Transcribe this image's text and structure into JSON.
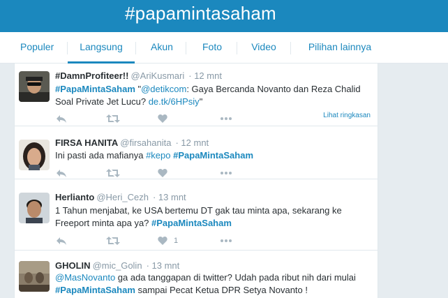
{
  "header": {
    "title": "#papamintasaham"
  },
  "nav": {
    "tabs": [
      {
        "label": "Populer",
        "active": false
      },
      {
        "label": "Langsung",
        "active": true
      },
      {
        "label": "Akun",
        "active": false
      },
      {
        "label": "Foto",
        "active": false
      },
      {
        "label": "Video",
        "active": false
      },
      {
        "label": "Pilihan lainnya",
        "active": false
      }
    ]
  },
  "tweets": [
    {
      "name": "#DamnProfiteer!!",
      "handle": "@AriKusmari",
      "time": "12 mnt",
      "text_parts": [
        {
          "t": "#PapaMintaSaham",
          "k": "tag"
        },
        {
          "t": " \"",
          "k": "plain"
        },
        {
          "t": "@detikcom",
          "k": "link"
        },
        {
          "t": ": Gaya Bercanda Novanto dan Reza Chalid Soal Private Jet Lucu? ",
          "k": "plain"
        },
        {
          "t": "de.tk/6HPsiy",
          "k": "link"
        },
        {
          "t": "\"",
          "k": "plain"
        }
      ],
      "summary_link": "Lihat ringkasan",
      "like_count": ""
    },
    {
      "name": "FIRSA HANITA",
      "handle": "@firsahanita",
      "time": "12 mnt",
      "text_parts": [
        {
          "t": "Ini pasti ada mafianya ",
          "k": "plain"
        },
        {
          "t": "#kepo",
          "k": "link"
        },
        {
          "t": " ",
          "k": "plain"
        },
        {
          "t": "#PapaMintaSaham",
          "k": "tag"
        }
      ],
      "summary_link": "",
      "like_count": ""
    },
    {
      "name": "Herlianto",
      "handle": "@Heri_Cezh",
      "time": "13 mnt",
      "text_parts": [
        {
          "t": "1 Tahun menjabat,  ke USA bertemu DT gak tau minta apa, sekarang ke Freeport minta apa ya? ",
          "k": "plain"
        },
        {
          "t": "#PapaMintaSaham",
          "k": "tag"
        }
      ],
      "summary_link": "",
      "like_count": "1"
    },
    {
      "name": "GHOLIN",
      "handle": "@mic_Golin",
      "time": "13 mnt",
      "text_parts": [
        {
          "t": "@MasNovanto",
          "k": "link"
        },
        {
          "t": " ga ada tanggapan di twitter? Udah pada ribut nih dari mulai ",
          "k": "plain"
        },
        {
          "t": "#PapaMintaSaham",
          "k": "tag"
        },
        {
          "t": " sampai Pecat Ketua DPR Setya Novanto !",
          "k": "plain"
        }
      ],
      "summary_link": "",
      "like_count": ""
    }
  ],
  "icons": [
    "reply-icon",
    "retweet-icon",
    "like-icon",
    "more-icon"
  ],
  "colors": {
    "accent": "#1b88be",
    "text": "#292f33",
    "muted": "#8899a6"
  }
}
